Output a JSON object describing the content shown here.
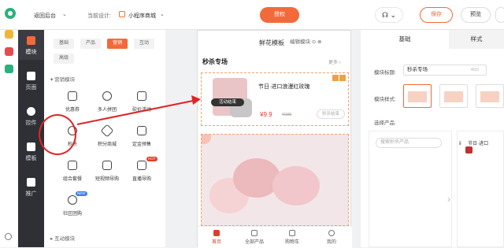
{
  "header": {
    "back_label": "返回后台",
    "current_design_label": "当前设计:",
    "shop_name": "小程序商城",
    "authorize_label": "授权",
    "save_label": "保存",
    "preview_label": "预览"
  },
  "nav": {
    "items": [
      {
        "label": "模块"
      },
      {
        "label": "页面"
      },
      {
        "label": "控件"
      },
      {
        "label": "模板"
      },
      {
        "label": "推广"
      }
    ]
  },
  "module_panel": {
    "tags": [
      "基础",
      "产品",
      "营销",
      "互动",
      "高级"
    ],
    "active_tag": "营销",
    "section_marketing": "营销模块",
    "section_interaction": "互动模块",
    "modules": [
      {
        "label": "优惠券"
      },
      {
        "label": "多人拼团"
      },
      {
        "label": "砍价活动"
      },
      {
        "label": "秒杀"
      },
      {
        "label": "积分商城"
      },
      {
        "label": "定金预售"
      },
      {
        "label": "组合套餐"
      },
      {
        "label": "短视频导购"
      },
      {
        "label": "直播导购"
      },
      {
        "label": "社区团购"
      }
    ],
    "badge_hot": "HOT",
    "badge_new": "NEW"
  },
  "canvas": {
    "title": "鲜花模板",
    "edit_module": "编辑模块",
    "seckill_title": "秒杀专场",
    "more": "更多",
    "product_name": "节日·进口浪漫红玫瑰",
    "activity_tag": "活动结束",
    "price": "¥9.9",
    "old_price": "¥288",
    "end_button": "秒杀结束",
    "tabbar": [
      "首页",
      "全部产品",
      "购物车",
      "我的"
    ]
  },
  "settings": {
    "tabs": [
      "基础",
      "样式"
    ],
    "module_title_label": "模块标题:",
    "module_title_value": "秒杀专场",
    "counter": "4/10",
    "module_style_label": "模块样式:",
    "select_product_label": "选择产品:",
    "search_placeholder": "搜索秒杀产品",
    "selected_item": "节日·进口"
  },
  "colors": {
    "accent": "#f26a3a",
    "nav_bg": "#2e3036",
    "annotation_red": "#e02424"
  }
}
